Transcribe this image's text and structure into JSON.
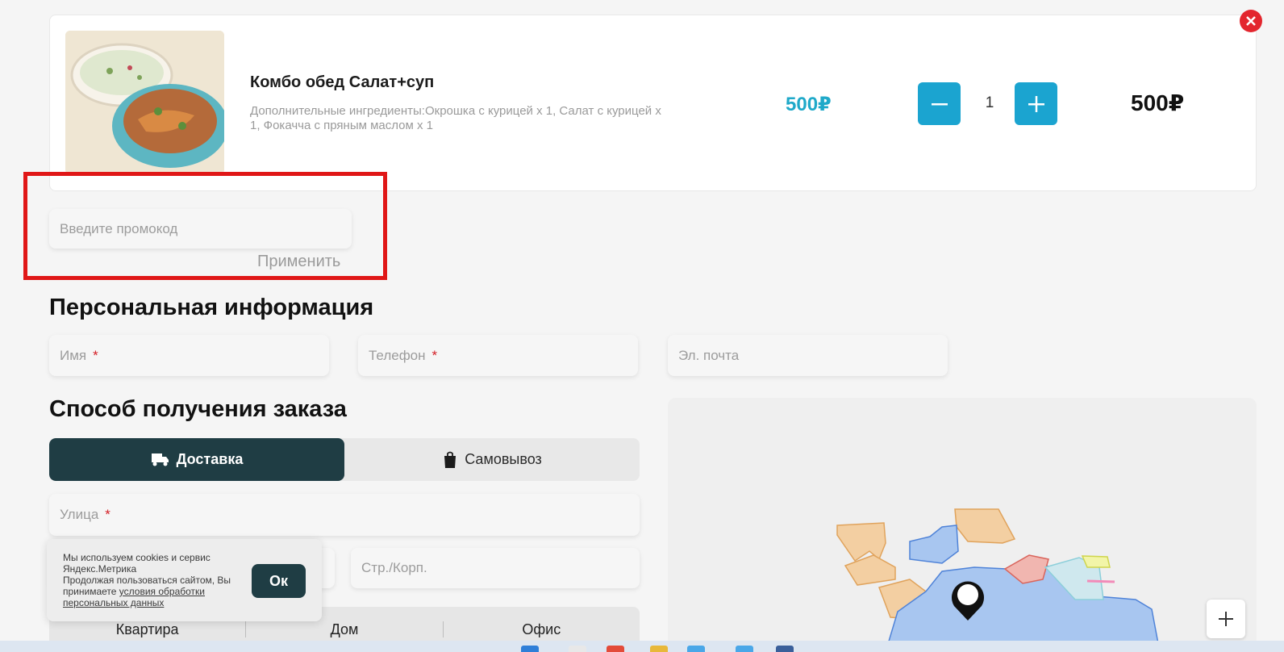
{
  "cart": {
    "item": {
      "title": "Комбо обед Салат+суп",
      "description": "Дополнительные ингредиенты:Окрошка с курицей х 1, Салат с курицей х 1, Фокачча с пряным маслом х 1",
      "unit_price": "500₽",
      "quantity": "1",
      "total": "500₽"
    }
  },
  "promo": {
    "placeholder": "Введите промокод",
    "apply_label": "Применить"
  },
  "personal": {
    "title": "Персональная информация",
    "name_placeholder": "Имя",
    "phone_placeholder": "Телефон",
    "email_placeholder": "Эл. почта",
    "required_mark": "*"
  },
  "delivery": {
    "title": "Способ получения заказа",
    "tabs": [
      {
        "label": "Доставка",
        "active": true
      },
      {
        "label": "Самовывоз",
        "active": false
      }
    ],
    "street_placeholder": "Улица",
    "building_placeholder": "Стр./Корп.",
    "sub_tabs": [
      "Квартира",
      "Дом",
      "Офис"
    ]
  },
  "cookie": {
    "line1": "Мы используем cookies и сервис Яндекс.Метрика",
    "line2_prefix": "Продолжая пользоваться сайтом, Вы принимаете ",
    "link_text": "условия обработки персональных данных",
    "ok_label": "Ок"
  },
  "map": {
    "zoom_in_label": "+"
  },
  "colors": {
    "accent": "#1ba4d0",
    "price": "#1fa9c9",
    "dark": "#1f3d44",
    "required": "#d42027",
    "highlight": "#e01717"
  }
}
